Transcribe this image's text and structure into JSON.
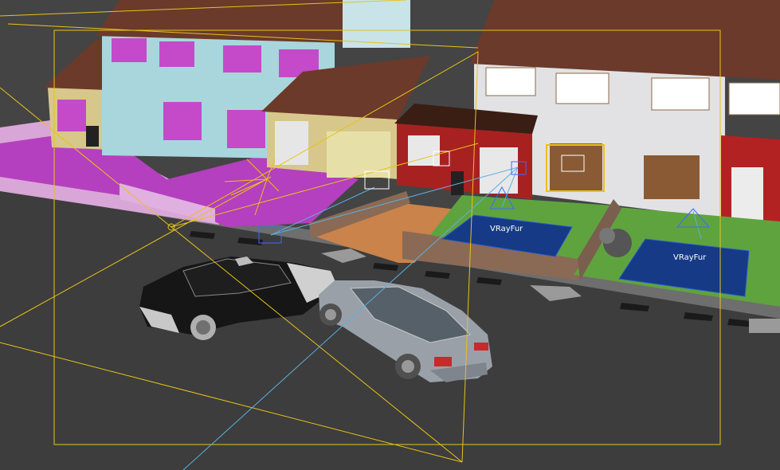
{
  "viewport": {
    "name": "3d-perspective-viewport",
    "colors": {
      "road": "#3f3f3f",
      "sky": "#4a4a4a",
      "roof": "#6b3a2a",
      "wall_left": "#d9c98c",
      "wall_blue": "#a9d6dc",
      "wall_right": "#e4e4e6",
      "window_magenta": "#c34ac9",
      "lawn_green": "#5fa33f",
      "fur_area_blue": "#163a86",
      "driveway_magenta": "#b63fbf",
      "camera_frustum": "#e8c21a",
      "light_line": "#5ab0e0",
      "car_black": "#1a1a1a",
      "car_silver": "#9aa0a8"
    }
  },
  "helpers": {
    "fur_label_1": "VRayFur",
    "fur_label_2": "VRayFur"
  }
}
